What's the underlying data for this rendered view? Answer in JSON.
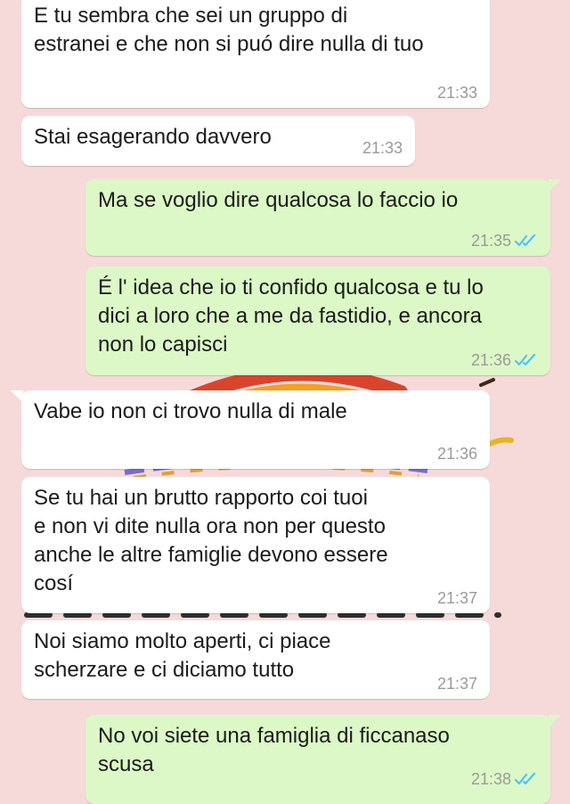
{
  "chat": {
    "messages": [
      {
        "direction": "in",
        "text": "E tu sembra che sei un gruppo di\nestranei e che non si puó dire nulla di tuo",
        "time": "21:33"
      },
      {
        "direction": "in",
        "text": "Stai esagerando davvero",
        "time": "21:33"
      },
      {
        "direction": "out",
        "text": "Ma se voglio dire qualcosa lo faccio io",
        "time": "21:35",
        "status": "read"
      },
      {
        "direction": "out",
        "text": "É l' idea che io ti confido qualcosa e tu lo\ndici a loro che a me da fastidio, e ancora\nnon lo capisci",
        "time": "21:36",
        "status": "read"
      },
      {
        "direction": "in",
        "text": "Vabe io non ci trovo nulla di male",
        "time": "21:36"
      },
      {
        "direction": "in",
        "text": "Se tu hai un brutto rapporto coi tuoi\ne non vi dite nulla ora non per questo\nanche le altre famiglie devono essere\ncosí",
        "time": "21:37"
      },
      {
        "direction": "in",
        "text": "Noi siamo molto aperti, ci piace\nscherzare e ci diciamo tutto",
        "time": "21:37"
      },
      {
        "direction": "out",
        "text": "No voi siete una famiglia di ficcanaso\nscusa",
        "time": "21:38",
        "status": "read"
      }
    ]
  },
  "theme": {
    "wallpaper_color": "#f6dada",
    "incoming_bubble": "#ffffff",
    "outgoing_bubble": "#dcf8c6",
    "read_tick_color": "#4fc3f7",
    "timestamp_color": "#9a9a9a"
  },
  "icons": {
    "read_receipt": "double-check-icon"
  }
}
